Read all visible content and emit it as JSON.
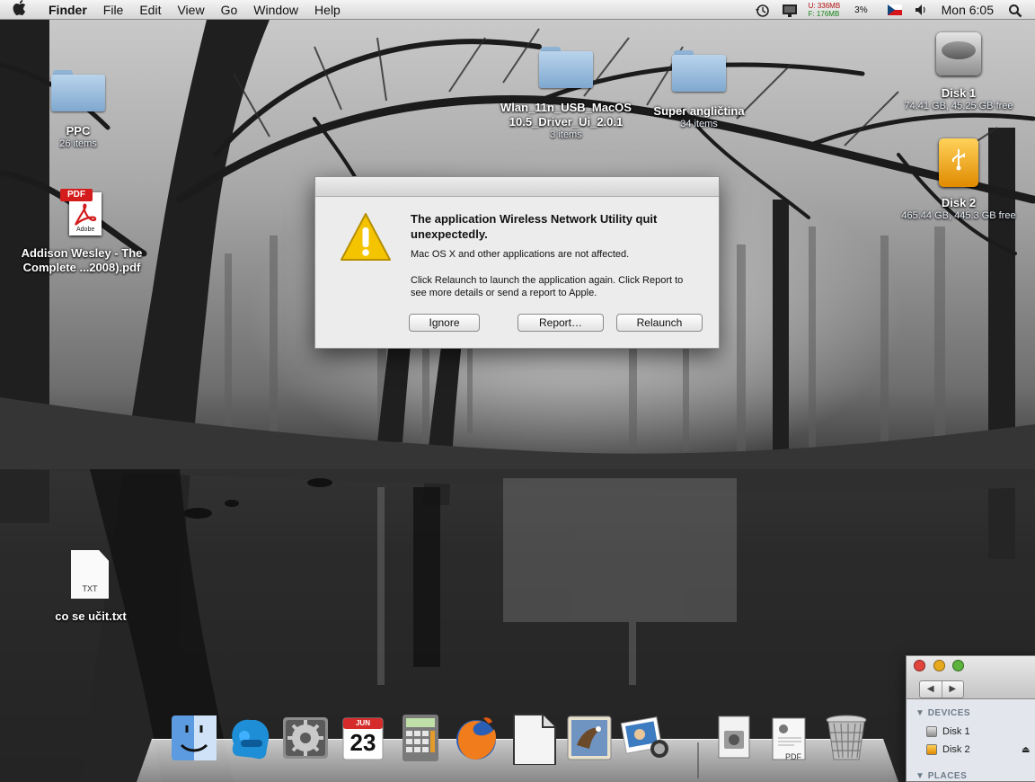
{
  "menubar": {
    "app_name": "Finder",
    "items": [
      "File",
      "Edit",
      "View",
      "Go",
      "Window",
      "Help"
    ],
    "memory_used": "U: 336MB",
    "memory_free": "F: 176MB",
    "cpu": "3%",
    "clock": "Mon 6:05",
    "icons": [
      "apple-icon",
      "time-machine-icon",
      "display-icon",
      "czech-flag-icon",
      "volume-icon",
      "spotlight-icon"
    ]
  },
  "desktop": {
    "ppc": {
      "label": "PPC",
      "sub": "26 items"
    },
    "pdf": {
      "badge": "PDF",
      "brand": "Adobe",
      "label1": "Addison Wesley - The",
      "label2": "Complete ...2008).pdf"
    },
    "wlan": {
      "label1": "Wlan_11n_USB_MacOS",
      "label2": "10.5_Driver_Ui_2.0.1",
      "sub": "3 items"
    },
    "super": {
      "label": "Super angličtina",
      "sub": "34 items"
    },
    "disk1": {
      "label": "Disk 1",
      "sub": "74.41 GB, 45.25 GB free"
    },
    "disk2": {
      "label": "Disk 2",
      "sub": "465.44 GB, 445.3 GB free"
    },
    "txt": {
      "badge": "TXT",
      "label": "co se učit.txt"
    }
  },
  "dialog": {
    "title": "The application Wireless Network Utility quit unexpectedly.",
    "line1": "Mac OS X and other applications are not affected.",
    "line2": "Click Relaunch to launch the application again. Click Report to see more details or send a report to Apple.",
    "ignore_label": "Ignore",
    "report_label": "Report…",
    "relaunch_label": "Relaunch"
  },
  "dock": {
    "items": [
      "finder-icon",
      "skype-icon",
      "system-preferences-icon",
      "ical-icon",
      "calculator-icon",
      "firefox-icon",
      "openoffice-icon",
      "mail-icon",
      "iphoto-icon",
      "preview-icon",
      "documents-stack-icon",
      "trash-icon"
    ],
    "calendar_month": "JUN",
    "calendar_day": "23",
    "pdf_stack_label": "PDF"
  },
  "finder_window": {
    "devices_header": "DEVICES",
    "disk1": "Disk 1",
    "disk2": "Disk 2",
    "places_header": "PLACES",
    "nav_back": "◀",
    "nav_forward": "▶"
  },
  "colors": {
    "folder_blue": "#8fb7dd",
    "alert_yellow": "#f5c400",
    "menubar_bg": "#e8e8e8"
  }
}
